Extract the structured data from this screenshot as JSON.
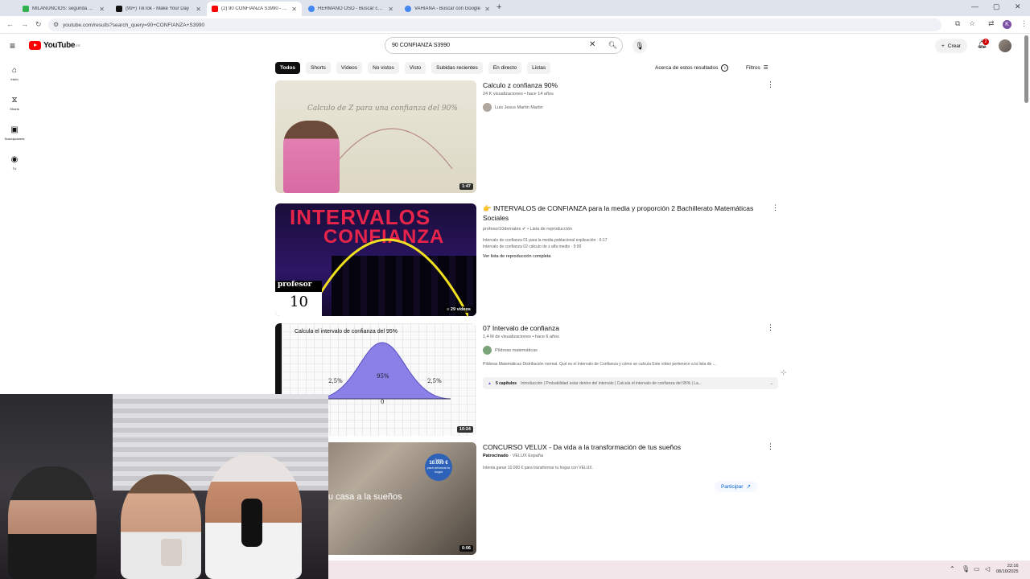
{
  "browser": {
    "tabs": [
      {
        "title": "MILANUNCIOS: segunda mano",
        "color": "#2fb24c",
        "active": false
      },
      {
        "title": "(99+) TikTok - Make Your Day",
        "color": "#111111",
        "active": false
      },
      {
        "title": "(2) 90 CONFIANZA S3990 - You",
        "color": "#ff0000",
        "active": true
      },
      {
        "title": "HERMANO OSO - Buscar con G",
        "color": "#4285f4",
        "active": false
      },
      {
        "title": "VAHIANA - Buscar con Google",
        "color": "#4285f4",
        "active": false
      }
    ],
    "url": "youtube.com/results?search_query=90+CONFIANZA+S3990",
    "profile_initial": "K"
  },
  "header": {
    "logo_text": "YouTube",
    "logo_region": "ES",
    "search_value": "90 CONFIANZA S3990",
    "create_label": "Crear",
    "notifications_count": "2"
  },
  "sidebar": {
    "items": [
      {
        "label": "Inicio",
        "icon": "home-icon"
      },
      {
        "label": "Shorts",
        "icon": "shorts-icon"
      },
      {
        "label": "Suscripciones",
        "icon": "subscriptions-icon"
      },
      {
        "label": "Tú",
        "icon": "you-icon"
      }
    ]
  },
  "chips": [
    "Todos",
    "Shorts",
    "Vídeos",
    "No vistos",
    "Visto",
    "Subidas recientes",
    "En directo",
    "Listas"
  ],
  "about_results": "Acerca de estos resultados",
  "filters_label": "Filtros",
  "results": [
    {
      "title": "Calculo z confianza 90%",
      "meta": "24 K visualizaciones • hace 14 años",
      "channel": "Luis Jesus Martin Martin",
      "duration": "1:47",
      "thumb_text": "Calculo de Z  para una confianza del 90%"
    },
    {
      "title": "👉 INTERVALOS de CONFIANZA para la media y proporción 2 Bachillerato Matemáticas Sociales",
      "channel": "profesor10demates",
      "channel_suffix": "• Lista de reproducción",
      "lines": [
        "Intervalo de confianza 01 para la media poblacional explicación · 6:17",
        "Intervalo de confianza 02 cálculo de z alfa medio · 5:00"
      ],
      "playlist_link": "Ver lista de reproducción completa",
      "thumb_line1": "INTERVALOS",
      "thumb_line2": "CONFIANZA",
      "thumb_prof": "profesor",
      "thumb_num": "10",
      "badge": "29 vídeos"
    },
    {
      "title": "07 Intervalo de confianza",
      "meta": "1,4 M de visualizaciones • hace 6 años",
      "channel": "Píldoras matemáticas",
      "desc": "Píldoras Matemáticas Distribución normal. Qué es el Intervalo de Confianza y cómo se calcula Este vídeo pertenece a la lista de ...",
      "chapters_count": "5 capítulos",
      "chapters_text": "Introducción | Probabilidad estar dentro del intervalo | Calcula el intervalo de confianza del 95% | La...",
      "duration": "10:24",
      "thumb_caption": "Calcula el intervalo de confianza del 95%",
      "thumb_center": "95%",
      "thumb_left": "2,5%",
      "thumb_right": "2,5%",
      "thumb_zero": "0"
    },
    {
      "title": "CONCURSO VELUX - Da vida a la transformación de tus sueños",
      "sponsored": "Patrocinado",
      "channel": "VELUX España",
      "desc": "Intenta ganar 10.000 € para transformar tu hogar con VELUX.",
      "cta": "Participar",
      "duration": "0:06",
      "thumb_text": "re tu casa a la sueños",
      "thumb_badge_top": "Gana",
      "thumb_badge_amount": "10.000 €",
      "thumb_badge_bottom": "para reformar tu hogar"
    }
  ],
  "taskbar": {
    "time": "22:16",
    "date": "08/10/2025"
  }
}
